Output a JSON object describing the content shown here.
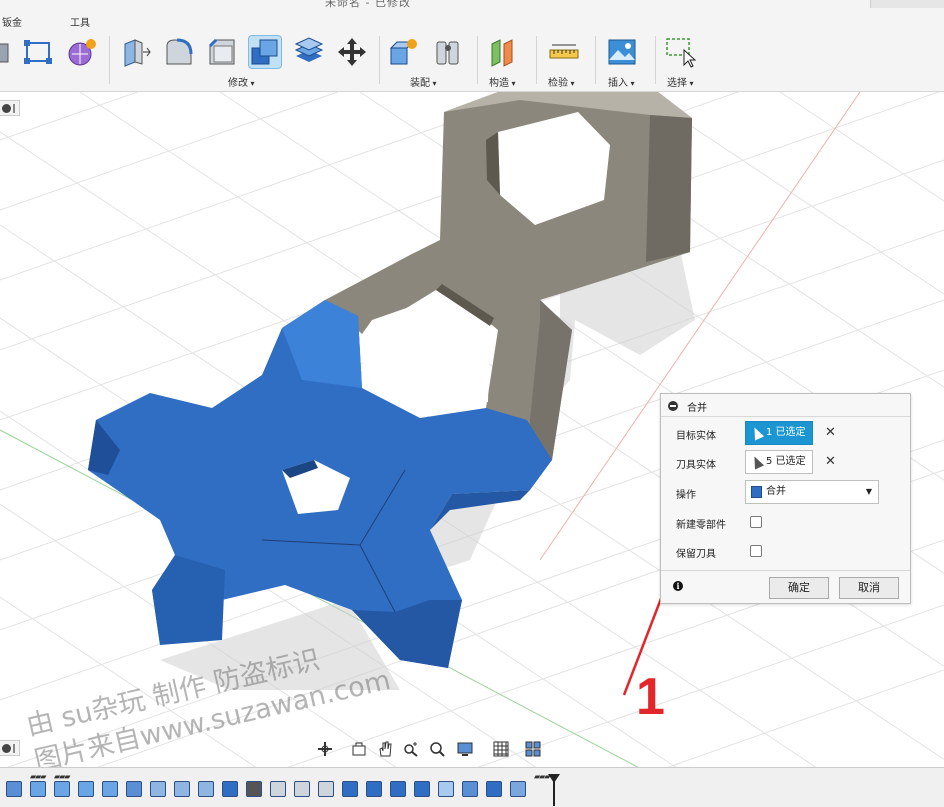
{
  "window": {
    "title": "未命名 - 已修改"
  },
  "toolbar": {
    "tabs": [
      {
        "label": "钣金"
      },
      {
        "label": "工具"
      }
    ],
    "groups": [
      {
        "label": "修改"
      },
      {
        "label": "装配"
      },
      {
        "label": "构造"
      },
      {
        "label": "检验"
      },
      {
        "label": "插入"
      },
      {
        "label": "选择"
      }
    ]
  },
  "dialog": {
    "title": "合并",
    "target_label": "目标实体",
    "target_value": "1 已选定",
    "tool_label": "刀具实体",
    "tool_value": "5 已选定",
    "operation_label": "操作",
    "operation_value": "合并",
    "new_component_label": "新建零部件",
    "keep_tools_label": "保留刀具",
    "ok_label": "确定",
    "cancel_label": "取消",
    "info_glyph": "i",
    "new_component_checked": false,
    "keep_tools_checked": false
  },
  "annotation": {
    "number": "1",
    "color": "#e3262a"
  },
  "watermark": {
    "line1": "由 su杂玩 制作 防盗标识",
    "line2": "图片来自www.suzawan.com"
  },
  "colors": {
    "accent": "#1b96d3",
    "blue_body": "#2f6ec2",
    "gray_body": "#8c877c"
  }
}
